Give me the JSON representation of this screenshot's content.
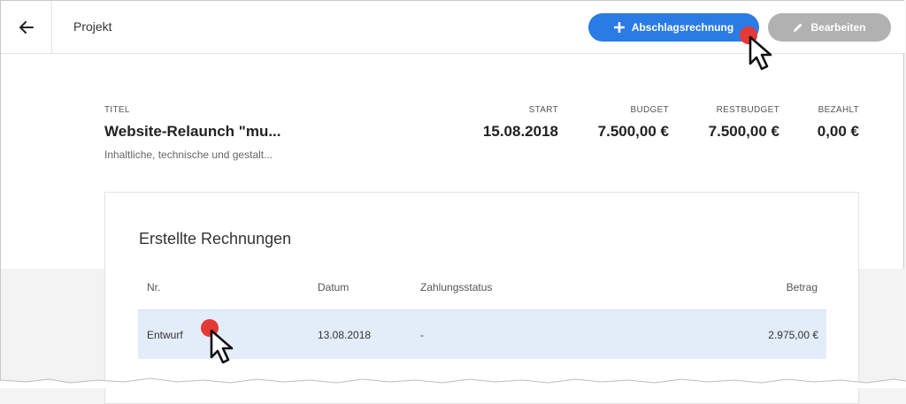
{
  "header": {
    "title": "Projekt",
    "primary_button": "Abschlagsrechnung",
    "secondary_button": "Bearbeiten"
  },
  "summary": {
    "title_label": "TITEL",
    "title_value": "Website-Relaunch \"mu...",
    "description": "Inhaltliche, technische und gestalt...",
    "start_label": "START",
    "start_value": "15.08.2018",
    "budget_label": "BUDGET",
    "budget_value": "7.500,00 €",
    "restbudget_label": "RESTBUDGET",
    "restbudget_value": "7.500,00 €",
    "paid_label": "BEZAHLT",
    "paid_value": "0,00 €"
  },
  "invoices": {
    "heading": "Erstellte Rechnungen",
    "columns": [
      "Nr.",
      "Datum",
      "Zahlungsstatus",
      "Betrag"
    ],
    "rows": [
      [
        "Entwurf",
        "13.08.2018",
        "-",
        "2.975,00 €"
      ]
    ]
  },
  "icons": {
    "back": "arrow-left-icon",
    "add": "plus-icon",
    "edit": "pencil-icon",
    "cursor": "mouse-pointer-icon"
  },
  "colors": {
    "primary": "#2b7be4",
    "secondary": "#b1b1b1",
    "row_highlight": "#e3edf9",
    "click_marker": "#e53935"
  }
}
